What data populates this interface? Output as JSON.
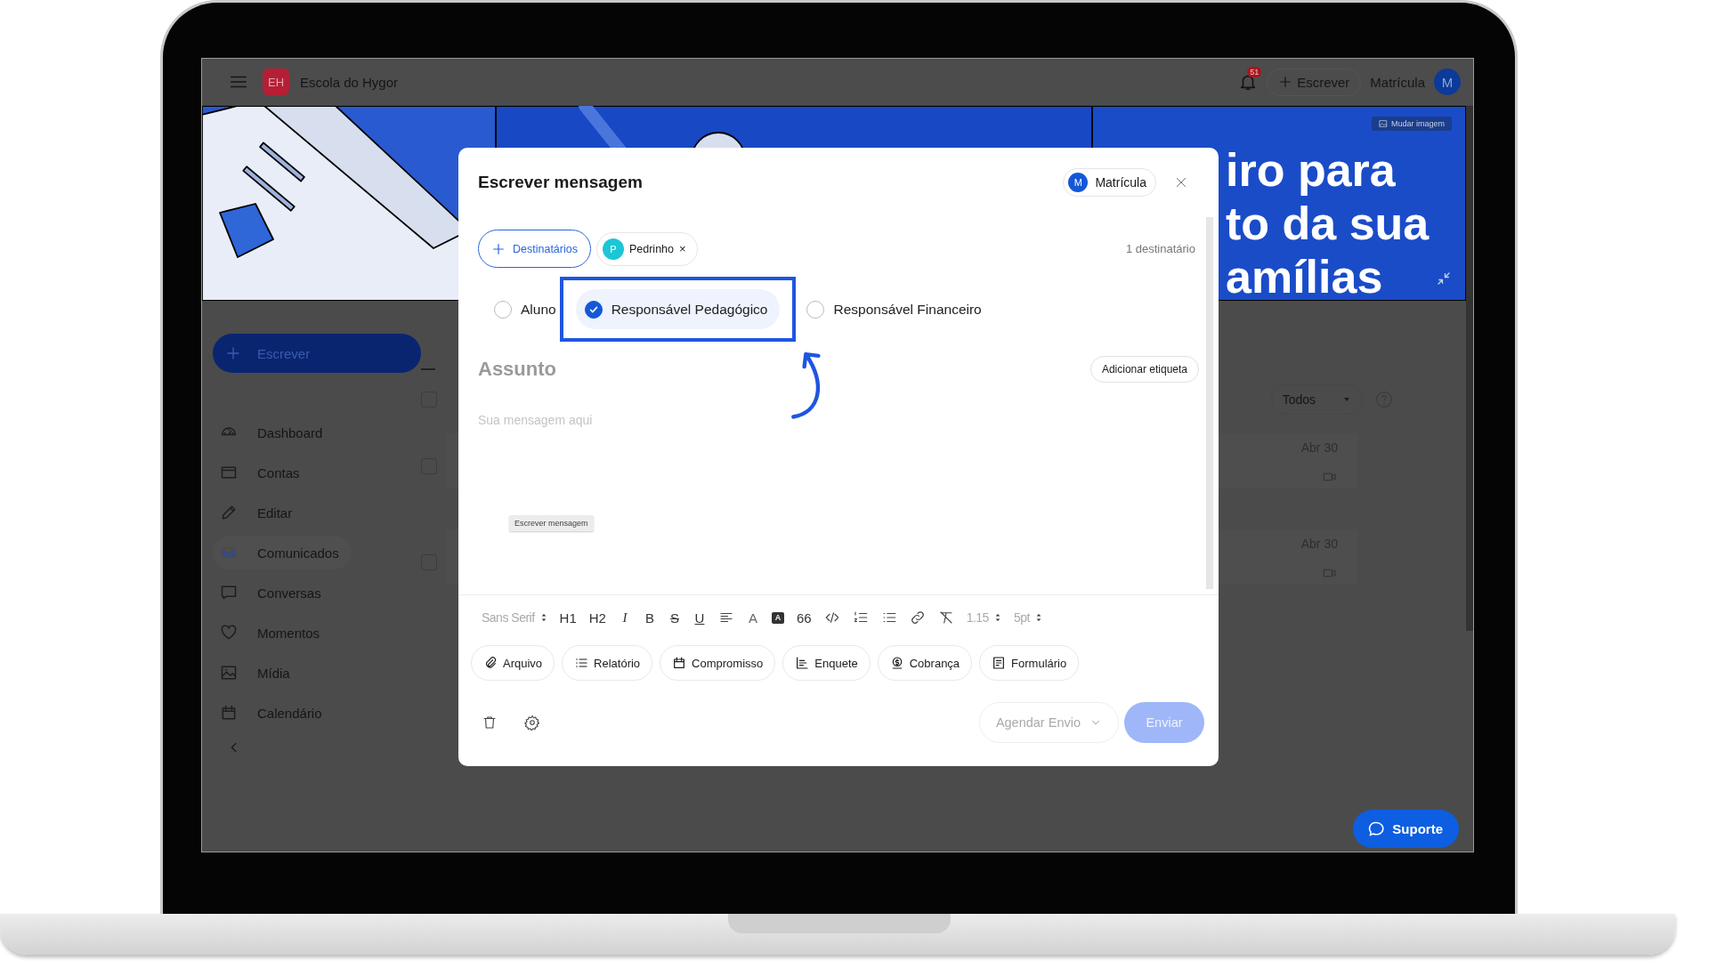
{
  "top_bar": {
    "app_initials": "EH",
    "school": "Escola do Hygor",
    "notifications": "51",
    "write_button": "Escrever",
    "user_label": "Matrícula",
    "user_initial": "M"
  },
  "banner": {
    "change_image": "Mudar imagem",
    "headline_lines": [
      "iro para",
      "to da sua",
      "amílias"
    ]
  },
  "sidebar": {
    "write_button": "Escrever",
    "items": [
      {
        "label": "Dashboard",
        "selected": false
      },
      {
        "label": "Contas",
        "selected": false
      },
      {
        "label": "Editar",
        "selected": false
      },
      {
        "label": "Comunicados",
        "selected": true
      },
      {
        "label": "Conversas",
        "selected": false
      },
      {
        "label": "Momentos",
        "selected": false
      },
      {
        "label": "Mídia",
        "selected": false
      },
      {
        "label": "Calendário",
        "selected": false
      }
    ]
  },
  "filter": {
    "value": "Todos",
    "select_all_checked": false
  },
  "messages": [
    {
      "date": "Abr 30",
      "checked": false
    },
    {
      "date": "Abr 30",
      "checked": false
    }
  ],
  "modal": {
    "title": "Escrever mensagem",
    "sender": {
      "initial": "M",
      "name": "Matrícula"
    },
    "recipients_button": "Destinatários",
    "recipients": [
      {
        "initial": "P",
        "name": "Pedrinho",
        "color": "#1cc6d6",
        "remove": "×"
      }
    ],
    "recipient_count": "1 destinatário",
    "audiences": [
      {
        "label": "Aluno",
        "selected": false
      },
      {
        "label": "Responsável Pedagógico",
        "selected": true
      },
      {
        "label": "Responsável Financeiro",
        "selected": false
      }
    ],
    "subject": {
      "placeholder": "Assunto"
    },
    "tag_button": "Adicionar etiqueta",
    "body": {
      "placeholder": "Sua mensagem aqui"
    },
    "tooltip": "Escrever mensagem",
    "toolbar": [
      {
        "kind": "select",
        "label": "Sans Serif"
      },
      {
        "kind": "text",
        "label": "H1"
      },
      {
        "kind": "text",
        "label": "H2"
      },
      {
        "kind": "italic",
        "label": "I"
      },
      {
        "kind": "bold",
        "label": "B"
      },
      {
        "kind": "strike",
        "label": "S"
      },
      {
        "kind": "underline",
        "label": "U"
      },
      {
        "kind": "align"
      },
      {
        "kind": "color",
        "label": "A"
      },
      {
        "kind": "highlight",
        "label": "A"
      },
      {
        "kind": "text",
        "label": "66"
      },
      {
        "kind": "code"
      },
      {
        "kind": "ordered"
      },
      {
        "kind": "bullets"
      },
      {
        "kind": "link"
      },
      {
        "kind": "clear"
      },
      {
        "kind": "select",
        "label": "1.15"
      },
      {
        "kind": "select",
        "label": "5pt"
      }
    ],
    "attachments": [
      "Arquivo",
      "Relatório",
      "Compromisso",
      "Enquete",
      "Cobrança",
      "Formulário"
    ],
    "schedule_button": "Agendar Envio",
    "send_button": {
      "label": "Enviar",
      "disabled": true
    }
  },
  "support_button": "Suporte"
}
